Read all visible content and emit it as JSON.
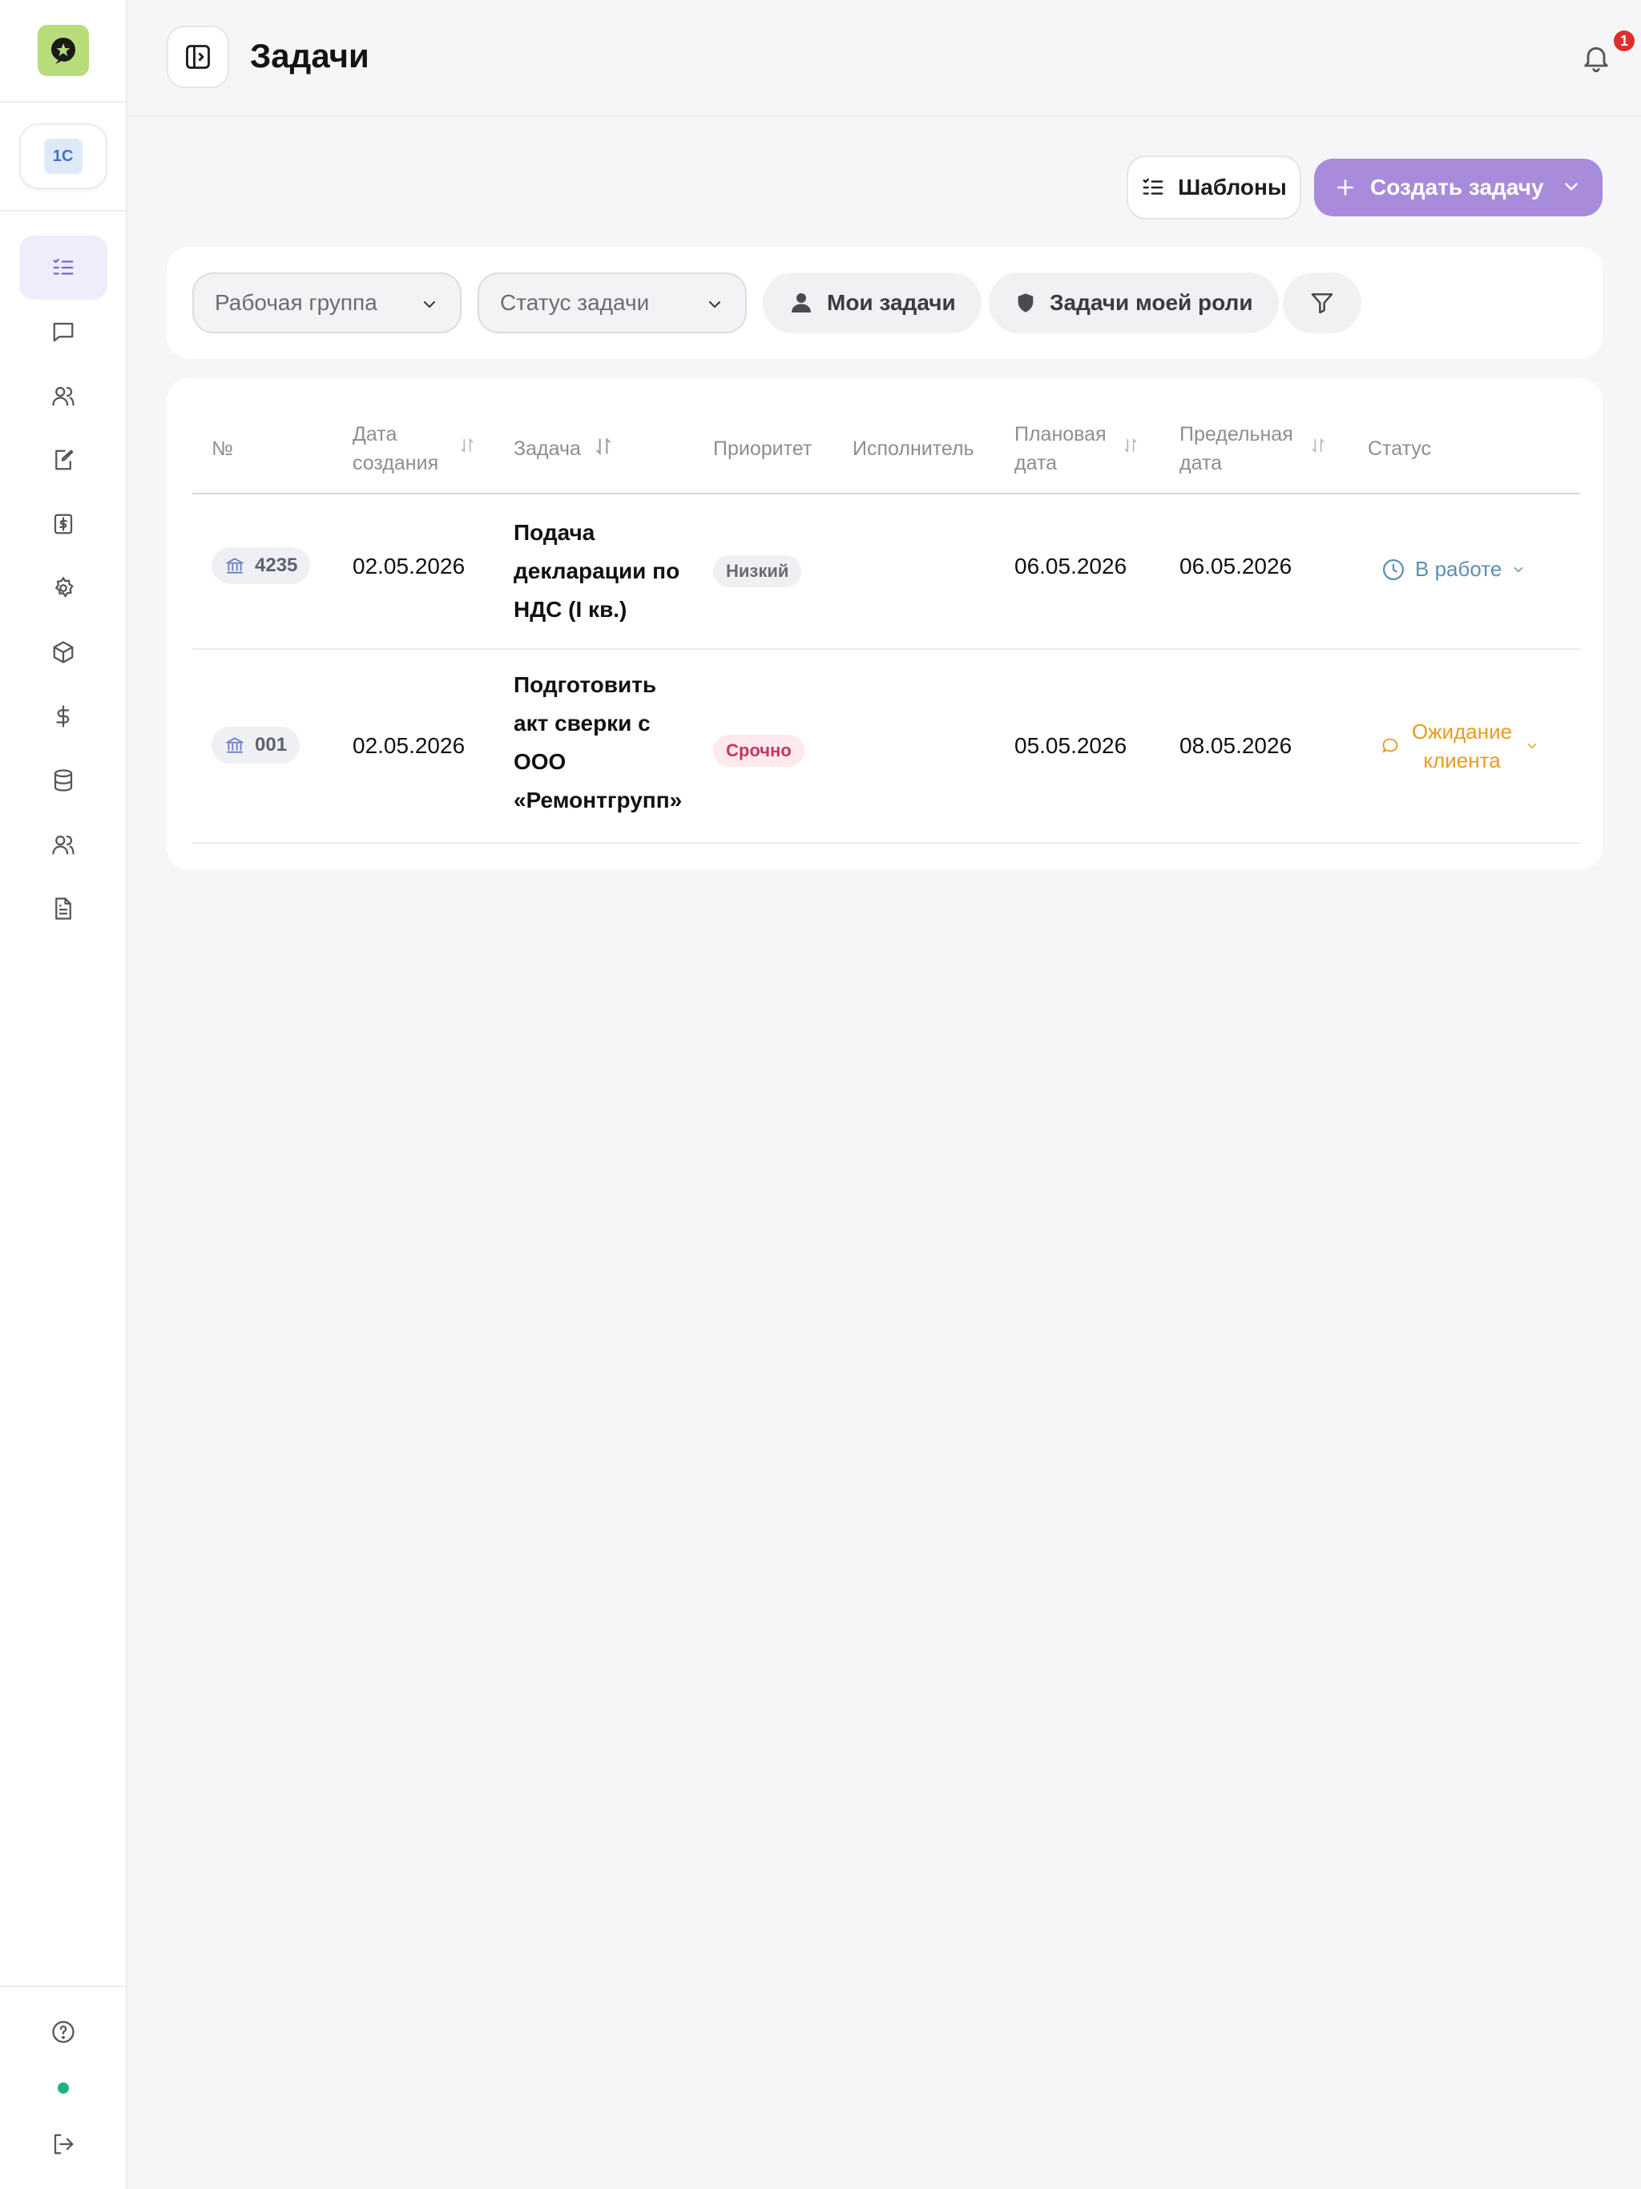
{
  "app": {
    "page_title": "Задачи",
    "notifications_count": "1",
    "org_badge": "1С"
  },
  "sidebar": {
    "items": [
      {
        "icon": "tasks-list-icon",
        "active": true
      },
      {
        "icon": "chat-icon"
      },
      {
        "icon": "clients-icon"
      },
      {
        "icon": "document-edit-icon"
      },
      {
        "icon": "invoice-icon"
      },
      {
        "icon": "settings-icon"
      },
      {
        "icon": "box-icon"
      },
      {
        "icon": "dollar-icon"
      },
      {
        "icon": "database-icon"
      },
      {
        "icon": "users-icon"
      },
      {
        "icon": "file-text-icon"
      }
    ],
    "bottom": [
      {
        "icon": "help-icon"
      },
      {
        "icon": "online-status-dot",
        "color": "#1fb37a"
      },
      {
        "icon": "logout-icon"
      }
    ]
  },
  "actions": {
    "templates_label": "Шаблоны",
    "create_label": "Создать задачу"
  },
  "filters": {
    "work_group_placeholder": "Рабочая группа",
    "task_status_placeholder": "Статус задачи",
    "my_tasks_label": "Мои задачи",
    "role_tasks_label": "Задачи моей роли"
  },
  "table": {
    "columns": {
      "number": "№",
      "created_date_1": "Дата",
      "created_date_2": "создания",
      "task": "Задача",
      "priority": "Приоритет",
      "assignee": "Исполнитель",
      "planned_date_1": "Плановая",
      "planned_date_2": "дата",
      "deadline_1": "Предельная",
      "deadline_2": "дата",
      "status": "Статус"
    },
    "rows": [
      {
        "number": "4235",
        "created": "02.05.2026",
        "task_lines": [
          "Подача",
          "декларации по",
          "НДС (I кв.)"
        ],
        "priority": "Низкий",
        "assignee": "",
        "planned": "06.05.2026",
        "deadline": "06.05.2026",
        "status": "В работе"
      },
      {
        "number": "001",
        "created": "02.05.2026",
        "task_lines": [
          "Подготовить",
          "акт сверки с",
          "ООО",
          "«Ремонтгрупп»"
        ],
        "priority": "Срочно",
        "assignee": "",
        "planned": "05.05.2026",
        "deadline": "08.05.2026",
        "status_lines": [
          "Ожидание",
          "клиента"
        ]
      }
    ]
  },
  "colors": {
    "accent": "#a98bdb",
    "logo_bg": "#b9dc7a",
    "status_work": "#5e8fb2",
    "status_wait": "#eb9b20",
    "urgent": "#c6355c"
  }
}
